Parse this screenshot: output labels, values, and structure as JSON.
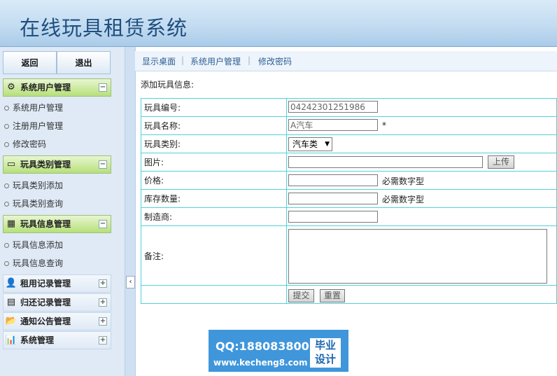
{
  "header": {
    "title": "在线玩具租赁系统"
  },
  "sidebar": {
    "back_label": "返回",
    "logout_label": "退出",
    "groups": [
      {
        "label": "系统用户管理",
        "icon": "gear-icon",
        "expanded": true,
        "items": [
          "系统用户管理",
          "注册用户管理",
          "修改密码"
        ]
      },
      {
        "label": "玩具类别管理",
        "icon": "monitor-icon",
        "expanded": true,
        "items": [
          "玩具类别添加",
          "玩具类别查询"
        ]
      },
      {
        "label": "玩具信息管理",
        "icon": "table-icon",
        "expanded": true,
        "items": [
          "玩具信息添加",
          "玩具信息查询"
        ]
      },
      {
        "label": "租用记录管理",
        "icon": "user-icon",
        "expanded": false,
        "items": []
      },
      {
        "label": "归还记录管理",
        "icon": "calendar-icon",
        "expanded": false,
        "items": []
      },
      {
        "label": "通知公告管理",
        "icon": "folder-icon",
        "expanded": false,
        "items": []
      },
      {
        "label": "系统管理",
        "icon": "chart-icon",
        "expanded": false,
        "items": []
      }
    ]
  },
  "tabs": [
    "显示桌面",
    "系统用户管理",
    "修改密码"
  ],
  "content": {
    "title": "添加玩具信息:",
    "fields": {
      "toy_id": {
        "label": "玩具编号:",
        "value": "04242301251986"
      },
      "toy_name": {
        "label": "玩具名称:",
        "value": "A汽车",
        "required_mark": "*"
      },
      "toy_category": {
        "label": "玩具类别:",
        "selected": "汽车类"
      },
      "image": {
        "label": "图片:",
        "value": "",
        "upload_label": "上传"
      },
      "price": {
        "label": "价格:",
        "value": "",
        "hint": "必需数字型"
      },
      "stock": {
        "label": "库存数量:",
        "value": "",
        "hint": "必需数字型"
      },
      "maker": {
        "label": "制造商:",
        "value": ""
      },
      "remark": {
        "label": "备注:",
        "value": ""
      }
    },
    "submit_label": "提交",
    "reset_label": "重置"
  },
  "watermark": {
    "qq": "QQ:188083800",
    "url": "www.kecheng8.com",
    "badge_line1": "毕业",
    "badge_line2": "设计"
  },
  "colors": {
    "accent_green": "#b7e07a",
    "table_border": "#4fd3da",
    "watermark_blue": "#3f96db"
  }
}
